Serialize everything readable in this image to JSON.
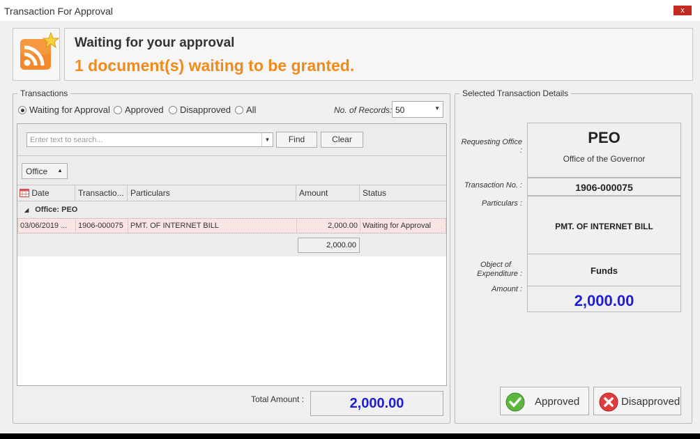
{
  "window": {
    "title": "Transaction For Approval",
    "close_label": "x"
  },
  "header": {
    "title": "Waiting for your approval",
    "subtitle": "1 document(s) waiting to be granted."
  },
  "transactions": {
    "legend": "Transactions",
    "filters": [
      {
        "label": "Waiting for Approval",
        "selected": true
      },
      {
        "label": "Approved",
        "selected": false
      },
      {
        "label": "Disapproved",
        "selected": false
      },
      {
        "label": "All",
        "selected": false
      }
    ],
    "records_label": "No. of Records:",
    "records_value": "50",
    "search_placeholder": "Enter text to search...",
    "find_label": "Find",
    "clear_label": "Clear",
    "group_by": "Office",
    "columns": [
      "Date",
      "Transactio...",
      "Particulars",
      "Amount",
      "Status"
    ],
    "group_label": "Office: PEO",
    "rows": [
      {
        "date": "03/06/2019 ...",
        "transaction_no": "1906-000075",
        "particulars": "PMT. OF  INTERNET BILL",
        "amount": "2,000.00",
        "status": "Waiting for Approval"
      }
    ],
    "group_sum": "2,000.00",
    "total_label": "Total Amount :",
    "total_value": "2,000.00"
  },
  "details": {
    "legend": "Selected Transaction Details",
    "requesting_office_label": "Requesting Office :",
    "office_code": "PEO",
    "office_name": "Office of the Governor",
    "transaction_no_label": "Transaction No. :",
    "transaction_no": "1906-000075",
    "particulars_label": "Particulars :",
    "particulars": "PMT. OF  INTERNET BILL",
    "object_label_line1": "Object of",
    "object_label_line2": "Expenditure :",
    "object_value": "Funds",
    "amount_label": "Amount :",
    "amount_value": "2,000.00"
  },
  "actions": {
    "approve_label": "Approved",
    "disapprove_label": "Disapproved"
  },
  "colors": {
    "accent_orange": "#f08a1a",
    "amount_blue": "#1e1ed6",
    "selected_row": "#fbe4e4"
  }
}
